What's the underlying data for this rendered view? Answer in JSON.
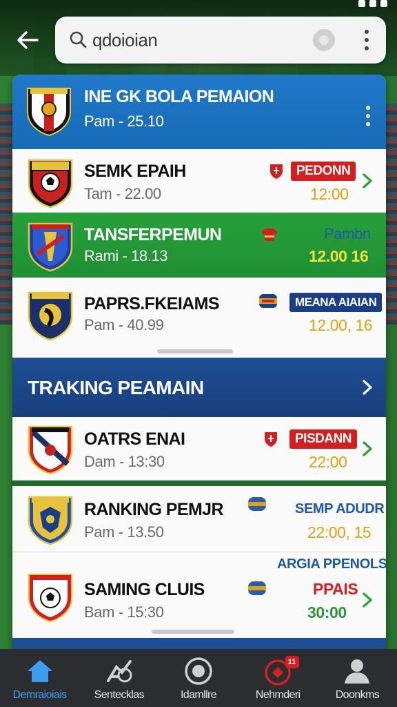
{
  "search": {
    "query": "qdoioian"
  },
  "header": {
    "title": "INE GK BOLA PEMAION",
    "subtitle": "Pam - 25.10"
  },
  "rows_top": [
    {
      "title": "SEMK EPAIH",
      "subtitle": "Tam - 22.00",
      "badge": "PEDONN",
      "value": "12:00"
    },
    {
      "title": "TANSFERPEMUN",
      "subtitle": "Rami - 18.13",
      "badge": "Pambn",
      "value": "12.00  16"
    },
    {
      "title": "PAPRS.FKEIAMS",
      "subtitle": "Pam - 40.99",
      "badge": "MEANA AIAIAN",
      "value": "12.00, 16"
    }
  ],
  "section": {
    "title": "TRAKING PEAMAIN"
  },
  "rows_bottom": [
    {
      "title": "OATRS ENAI",
      "subtitle": "Dam - 13:30",
      "badge": "PISDANN",
      "value": "22:00"
    },
    {
      "title": "RANKING PEMJR",
      "subtitle": "Pam - 13.50",
      "badge": "SEMP ADUDR",
      "value": "22:00, 15"
    },
    {
      "title": "SAMING CLUIS",
      "subtitle": "Bam - 15:30",
      "badge": "ARGIA PPENOLSA",
      "value_top": "PPAIS",
      "value": "30:00"
    }
  ],
  "nav": [
    {
      "label": "Demraioiais",
      "icon": "home-icon"
    },
    {
      "label": "Sentecklas",
      "icon": "fixtures-icon"
    },
    {
      "label": "Idamllre",
      "icon": "ball-icon"
    },
    {
      "label": "Nehmderi",
      "icon": "notifications-icon",
      "badge": "11"
    },
    {
      "label": "Doonkms",
      "icon": "profile-icon"
    }
  ],
  "colors": {
    "brand_blue": "#1f78c8",
    "green": "#26a13a",
    "navy": "#1d4e94",
    "accent_red": "#d41f20",
    "value_gold": "#e2a20c"
  }
}
